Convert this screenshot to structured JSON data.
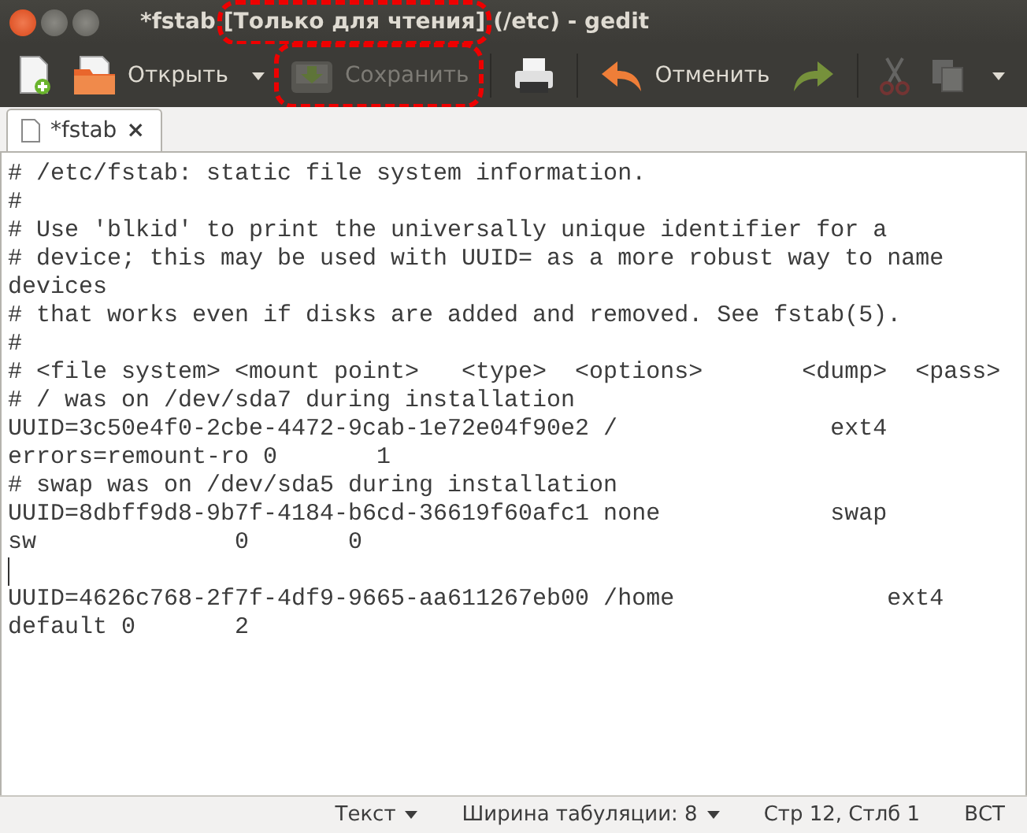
{
  "window": {
    "title_parts": [
      {
        "text": "*fstab",
        "highlighted": false
      },
      {
        "text": "[Только для чтения]",
        "highlighted": true
      },
      {
        "text": "(/etc) - gedit",
        "highlighted": false
      }
    ]
  },
  "toolbar": [
    {
      "kind": "icon",
      "disabled": false,
      "highlighted": false
    },
    {
      "kind": "labeled",
      "label": "Открыть",
      "disabled": false,
      "highlighted": false,
      "menu": true
    },
    {
      "kind": "labeled",
      "label": "Сохранить",
      "disabled": true,
      "highlighted": true,
      "menu": false
    },
    {
      "kind": "icon",
      "disabled": false,
      "highlighted": false
    },
    {
      "kind": "labeled",
      "label": "Отменить",
      "disabled": false,
      "highlighted": false,
      "menu": false
    },
    {
      "kind": "icon",
      "disabled": false,
      "highlighted": false
    },
    {
      "kind": "icon",
      "disabled": true,
      "highlighted": false
    },
    {
      "kind": "icon",
      "disabled": true,
      "highlighted": false
    },
    {
      "kind": "overflow"
    }
  ],
  "tabs": [
    {
      "label": "*fstab",
      "selected": true,
      "close": "×"
    }
  ],
  "editor": {
    "lines": [
      {
        "text": "# /etc/fstab: static file system information."
      },
      {
        "text": "#"
      },
      {
        "text": "# Use 'blkid' to print the universally unique identifier for a"
      },
      {
        "text": "# device; this may be used with UUID= as a more robust way to name"
      },
      {
        "text": "devices"
      },
      {
        "text": "# that works even if disks are added and removed. See fstab(5)."
      },
      {
        "text": "#"
      },
      {
        "text": "# <file system> <mount point>   <type>  <options>       <dump>  <pass>"
      },
      {
        "text": "# / was on /dev/sda7 during installation"
      },
      {
        "text": "UUID=3c50e4f0-2cbe-4472-9cab-1e72e04f90e2 /               ext4"
      },
      {
        "text": "errors=remount-ro 0       1"
      },
      {
        "text": "# swap was on /dev/sda5 during installation"
      },
      {
        "text": "UUID=8dbff9d8-9b7f-4184-b6cd-36619f60afc1 none            swap"
      },
      {
        "text": "sw              0       0"
      },
      {
        "cursor": true
      },
      {
        "text": "UUID=4626c768-2f7f-4df9-9665-aa611267eb00 /home               ext4"
      },
      {
        "text": "default 0       2"
      }
    ]
  },
  "status_bar": {
    "language": "Текст",
    "tab_width": "Ширина табуляции: 8",
    "position": "Стр 12, Стлб 1",
    "mode": "ВСТ"
  }
}
